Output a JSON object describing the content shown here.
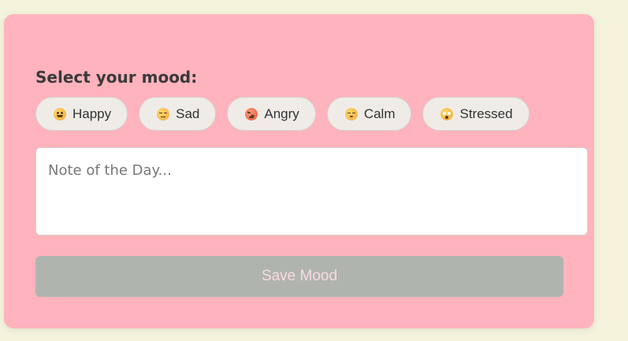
{
  "form": {
    "title": "Select your mood:",
    "moods": [
      {
        "label": "Happy",
        "icon": "happy-emoji-icon"
      },
      {
        "label": "Sad",
        "icon": "sad-emoji-icon"
      },
      {
        "label": "Angry",
        "icon": "angry-emoji-icon"
      },
      {
        "label": "Calm",
        "icon": "calm-emoji-icon"
      },
      {
        "label": "Stressed",
        "icon": "stressed-emoji-icon"
      }
    ],
    "note_placeholder": "Note of the Day...",
    "note_value": "",
    "save_label": "Save Mood"
  },
  "colors": {
    "background": "#f4f3dc",
    "card": "#ffb3bd",
    "mood_button": "#efece8",
    "save_button": "#b0b4ae",
    "save_text": "#f8dbe2"
  }
}
